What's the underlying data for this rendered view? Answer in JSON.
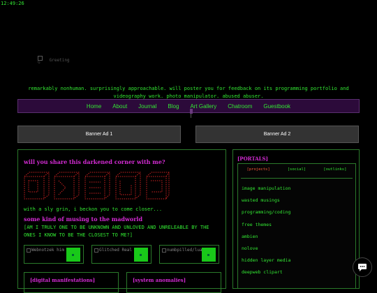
{
  "clock": "12:49:26",
  "logo": {
    "alt": "Greeting",
    "mark": "G"
  },
  "tagline": "remarkably nonhuman. surprisingly approachable. will poster you for feedback on its programming portfolio and videography work. photo manipulator. abused abuser.",
  "nav": {
    "items": [
      "Home",
      "About",
      "Journal",
      "Blog",
      "Art Gallery",
      "Chatroom",
      "Guestbook"
    ]
  },
  "banners": {
    "left": "Banner Ad 1",
    "right": "Banner Ad 2"
  },
  "main": {
    "heading1": "will you share this darkened corner with me?",
    "heading2": "some kind of musing to the madworld",
    "grin_text": "with a sly grin, i beckon you to come closer...",
    "shout_text": "[AM I TRULY ONE TO BE UNKNOWN AND UNLOVED AND UNRELEABLE BY THE ONES I KNOW TO BE THE CLOSEST TO ME?]",
    "buttons": [
      "Webnotzek him",
      "Glitched Real",
      "numbpilled/lua"
    ],
    "sub_headings": [
      "[digital manifestations]",
      "[system anomalies]"
    ]
  },
  "portals": {
    "title": "[PORTALS]",
    "tabs": [
      "[projects]",
      "[social]",
      "[outlinks]"
    ],
    "active_tab": "[projects]",
    "links": [
      "image manipulation",
      "wasted musings",
      "programming/coding",
      "free themes",
      "ambien",
      "nolove",
      "hidden layer media",
      "deepweb clipart"
    ]
  },
  "colors": {
    "background": "#000000",
    "text_green": "#33e833",
    "heading_pink": "#d22bd2",
    "nav_purple": "#2c0a3a",
    "active_tab": "#ff5a3a"
  },
  "icons": {
    "chat": "chat-bubble-icon"
  }
}
